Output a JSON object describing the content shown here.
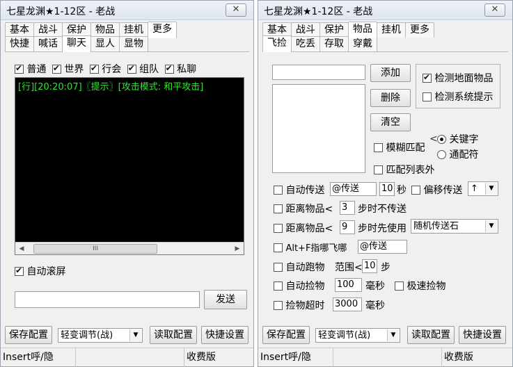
{
  "window_title": "七星龙渊★1-12区 - 老战",
  "close_glyph": "✕",
  "tabs_row1": [
    "基本",
    "战斗",
    "保护",
    "物品",
    "挂机",
    "更多"
  ],
  "left": {
    "tabs_row2": [
      "快捷",
      "喊话",
      "聊天",
      "显人",
      "显物"
    ],
    "channels": [
      "普通",
      "世界",
      "行会",
      "组队",
      "私聊"
    ],
    "chat_line": "[行][20:20:07]〖提示〗[攻击模式: 和平攻击]",
    "scroll_thumb": "III",
    "auto_scroll": "自动滚屏",
    "message_value": "",
    "send": "发送"
  },
  "right": {
    "tabs_row2": [
      "飞捡",
      "吃丢",
      "存取",
      "穿戴"
    ],
    "item_name_value": "",
    "add": "添加",
    "delete": "删除",
    "clear": "清空",
    "detect_ground": "检测地面物品",
    "detect_system": "检测系统提示",
    "fuzzy": "模糊匹配",
    "keyword": "关键字",
    "wildcard": "通配符",
    "match_outside": "匹配列表外",
    "auto_teleport": "自动传送",
    "auto_teleport_value": "@传送",
    "seconds_value": "10",
    "seconds_unit": "秒",
    "offset_teleport": "偏移传送",
    "offset_dir": "↑",
    "dist_label1": "距离物品<",
    "dist_value1": "3",
    "dist_suffix1": "步时不传送",
    "dist_label2": "距离物品<",
    "dist_value2": "9",
    "dist_suffix2": "步时先使用",
    "dist_item": "随机传送石",
    "altf_label": "Alt+F指哪飞哪",
    "altf_value": "@传送",
    "auto_run": "自动跑物",
    "range_label": "范围<",
    "range_value": "10",
    "range_unit": "步",
    "auto_pick": "自动捡物",
    "pick_ms": "100",
    "ms_unit1": "毫秒",
    "fast_pick": "极速捡物",
    "timeout_label": "捡物超时",
    "timeout_value": "3000",
    "ms_unit2": "毫秒"
  },
  "bottom": {
    "save_config": "保存配置",
    "mode_select": "轻变调节(战)",
    "read_config": "读取配置",
    "shortcut_settings": "快捷设置"
  },
  "status": {
    "insert": "Insert呼/隐",
    "charge": "收费版"
  }
}
